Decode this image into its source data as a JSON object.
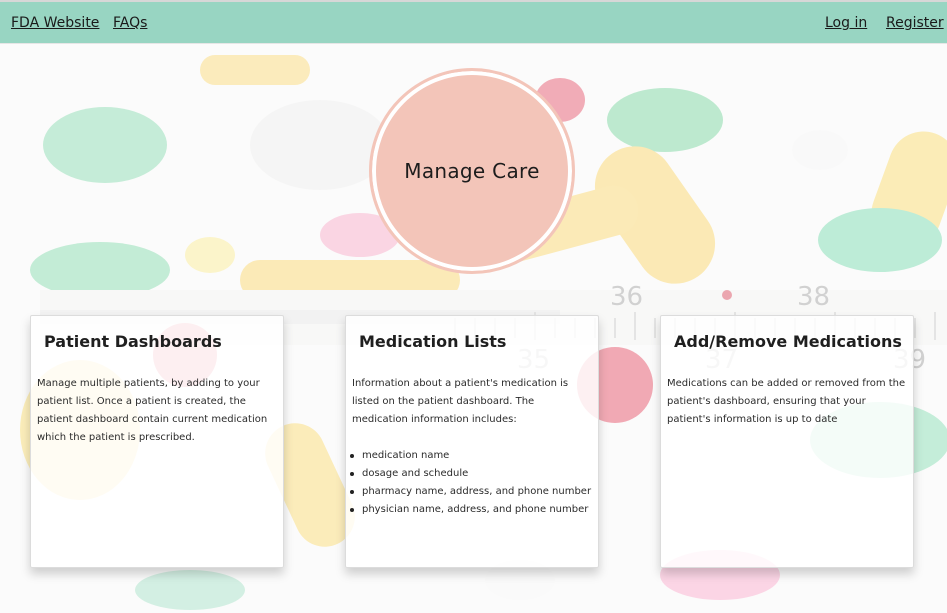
{
  "nav": {
    "left": [
      {
        "label": "FDA Website"
      },
      {
        "label": "FAQs"
      }
    ],
    "right": [
      {
        "label": "Log in"
      },
      {
        "label": "Register"
      }
    ]
  },
  "hero": {
    "title": "Manage Care",
    "circle_color": "#f3c5b9"
  },
  "cards": [
    {
      "title": "Patient Dashboards",
      "text": "Manage multiple patients, by adding to your patient list. Once a patient is created, the patient dashboard contain current medication which the patient is prescribed."
    },
    {
      "title": "Medication Lists",
      "text": "Information about a patient's medication is listed on the patient dashboard. The medication information includes:",
      "list": [
        "medication name",
        "dosage and schedule",
        "pharmacy name, address, and phone number",
        "physician name, address, and phone number"
      ]
    },
    {
      "title": "Add/Remove Medications",
      "text": "Medications can be added or removed from the patient's dashboard, ensuring that your patient's information is up to date"
    }
  ],
  "colors": {
    "navbar": "#98d5c2",
    "accent": "#f3c5b9"
  }
}
